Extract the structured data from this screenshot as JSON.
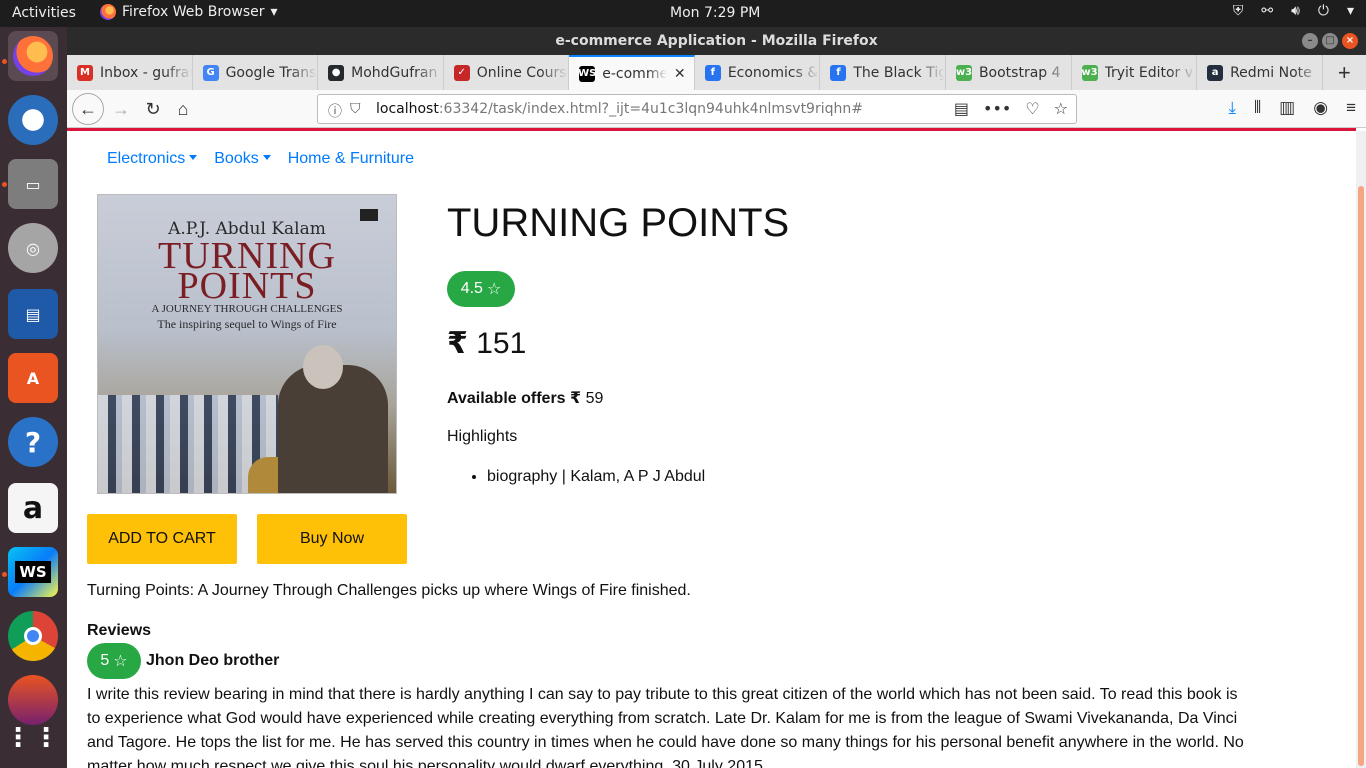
{
  "topbar": {
    "activities": "Activities",
    "app_menu": "Firefox Web Browser",
    "clock": "Mon  7:29 PM"
  },
  "window": {
    "title": "e-commerce Application - Mozilla Firefox"
  },
  "tabs": [
    {
      "label": "Inbox - gufran",
      "icon": "gmail-icon",
      "color": "#d93025"
    },
    {
      "label": "Google Translate",
      "icon": "google-translate-icon",
      "color": "#4285f4"
    },
    {
      "label": "MohdGufran",
      "icon": "github-icon",
      "color": "#24292e"
    },
    {
      "label": "Online Course",
      "icon": "online-course-icon",
      "color": "#c62828"
    },
    {
      "label": "e-commerce",
      "icon": "webstorm-icon",
      "color": "#000000",
      "active": true
    },
    {
      "label": "Economics &",
      "icon": "flipkart-icon",
      "color": "#2874f0"
    },
    {
      "label": "The Black Tiger",
      "icon": "flipkart-icon",
      "color": "#2874f0"
    },
    {
      "label": "Bootstrap 4",
      "icon": "w3schools-icon",
      "color": "#4caf50"
    },
    {
      "label": "Tryit Editor v",
      "icon": "w3schools-icon",
      "color": "#4caf50"
    },
    {
      "label": "Redmi Note",
      "icon": "amazon-icon",
      "color": "#232f3e"
    }
  ],
  "url": {
    "host": "localhost",
    "rest": ":63342/task/index.html?_ijt=4u1c3lqn94uhk4nlmsvt9riqhn#"
  },
  "catnav": {
    "electronics": "Electronics",
    "books": "Books",
    "home": "Home & Furniture"
  },
  "cover": {
    "author": "A.P.J. Abdul Kalam",
    "title_line1": "TURNING",
    "title_line2": "POINTS",
    "subtitle": "A JOURNEY THROUGH CHALLENGES",
    "tagline": "The inspiring sequel to Wings of Fire"
  },
  "product": {
    "title": "TURNING POINTS",
    "rating": "4.5",
    "currency": "₹",
    "price": "151",
    "offers_label": "Available offers",
    "offers_value": "59",
    "highlights_label": "Highlights",
    "highlights": [
      "biography | Kalam, A P J Abdul"
    ],
    "add_to_cart": "ADD TO CART",
    "buy_now": "Buy Now",
    "description": "Turning Points: A Journey Through Challenges picks up where Wings of Fire finished."
  },
  "reviews": {
    "heading": "Reviews",
    "items": [
      {
        "rating": "5",
        "name": "Jhon Deo brother",
        "text": "I write this review bearing in mind that there is hardly anything I can say to pay tribute to this great citizen of the world which has not been said. To read this book is to experience what God would have experienced while creating everything from scratch. Late Dr. Kalam for me is from the league of Swami Vivekananda, Da Vinci and Tagore. He tops the list for me. He has served this country in times when he could have done so many things for his personal benefit anywhere in the world. No matter how much respect we give this soul his personality would dwarf everything. 30 July 2015"
      }
    ]
  },
  "colors": {
    "accent": "#007bff",
    "success": "#28a745",
    "warning": "#ffc107",
    "firefox_red_line": "#dc143c"
  }
}
